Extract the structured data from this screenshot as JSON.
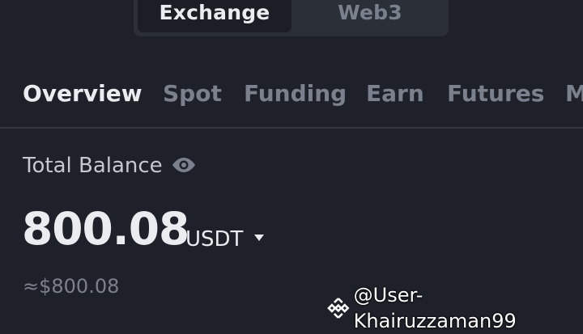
{
  "header": {
    "segments": [
      {
        "label": "Exchange",
        "active": true
      },
      {
        "label": "Web3",
        "active": false
      }
    ]
  },
  "tabs": [
    {
      "label": "Overview",
      "active": true
    },
    {
      "label": "Spot",
      "active": false
    },
    {
      "label": "Funding",
      "active": false
    },
    {
      "label": "Earn",
      "active": false
    },
    {
      "label": "Futures",
      "active": false
    },
    {
      "label": "M",
      "active": false
    }
  ],
  "balance": {
    "label": "Total Balance",
    "amount": "800.08",
    "currency": "USDT",
    "approx": "≈$800.08",
    "visibility_icon": "eye-icon",
    "currency_dropdown_icon": "caret-down-icon"
  },
  "watermark": {
    "text": "@User-Khairuzzaman99",
    "logo_icon": "binance-logo-icon"
  },
  "colors": {
    "background": "#1e2129",
    "primary_text": "#eaecef",
    "secondary_text": "#7b818c",
    "divider": "#343843"
  }
}
